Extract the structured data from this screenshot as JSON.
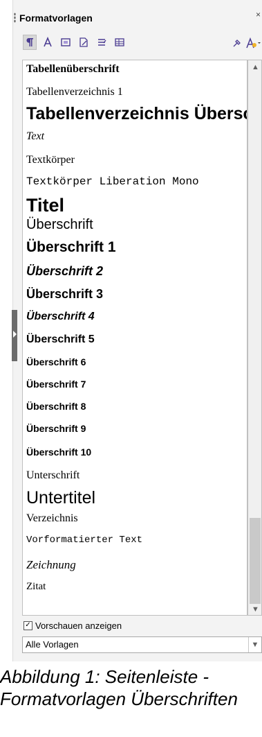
{
  "panel": {
    "title": "Formatvorlagen",
    "close_symbol": "×",
    "toolbar": {
      "icons": [
        "paragraph-styles-icon",
        "character-styles-icon",
        "frame-styles-icon",
        "page-styles-icon",
        "list-styles-icon",
        "table-styles-icon"
      ],
      "right_icons": [
        "fill-format-mode-icon",
        "new-style-icon"
      ]
    },
    "styles": [
      {
        "label": "Tabellenüberschrift"
      },
      {
        "label": "Tabellenverzeichnis 1"
      },
      {
        "label": "Tabellenverzeichnis Überschrift"
      },
      {
        "label": "Text"
      },
      {
        "label": "Textkörper"
      },
      {
        "label": "Textkörper Liberation Mono"
      },
      {
        "label": "Titel"
      },
      {
        "label": "Überschrift"
      },
      {
        "label": "Überschrift 1"
      },
      {
        "label": "Überschrift 2"
      },
      {
        "label": "Überschrift 3"
      },
      {
        "label": "Überschrift 4"
      },
      {
        "label": "Überschrift 5"
      },
      {
        "label": "Überschrift 6"
      },
      {
        "label": "Überschrift 7"
      },
      {
        "label": "Überschrift 8"
      },
      {
        "label": "Überschrift 9"
      },
      {
        "label": "Überschrift 10"
      },
      {
        "label": "Unterschrift"
      },
      {
        "label": "Untertitel"
      },
      {
        "label": "Verzeichnis"
      },
      {
        "label": "Vorformatierter Text"
      },
      {
        "label": "Zeichnung"
      },
      {
        "label": "Zitat"
      }
    ],
    "show_previews": {
      "label": "Vorschauen anzeigen",
      "checked": true
    },
    "filter": {
      "value": "Alle Vorlagen"
    }
  },
  "caption": "Abbildung 1: Seitenleiste - Formatvorlagen Überschriften"
}
